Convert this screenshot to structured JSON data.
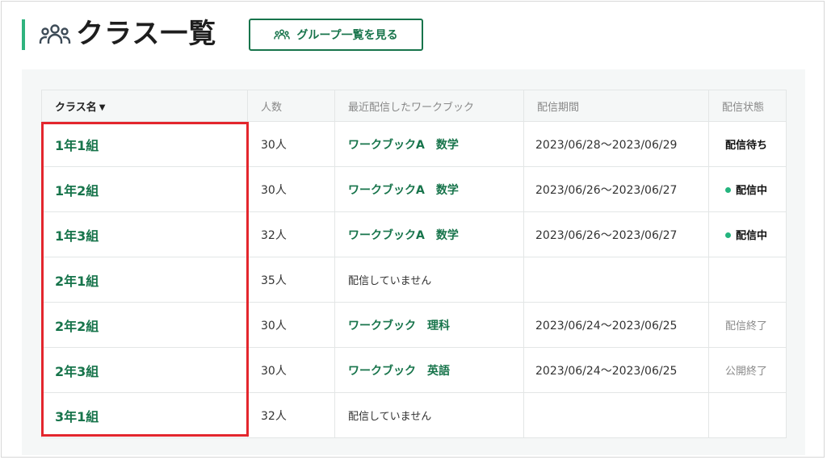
{
  "header": {
    "title": "クラス一覧",
    "group_button_label": "グループ一覧を見る"
  },
  "table": {
    "columns": [
      "クラス名",
      "人数",
      "最近配信したワークブック",
      "配信期間",
      "配信状態"
    ],
    "rows": [
      {
        "name": "1年1組",
        "count": "30人",
        "workbook": "ワークブックA　数学",
        "period": "2023/06/28〜2023/06/29",
        "status": "配信待ち"
      },
      {
        "name": "1年2組",
        "count": "30人",
        "workbook": "ワークブックA　数学",
        "period": "2023/06/26〜2023/06/27",
        "status": "配信中"
      },
      {
        "name": "1年3組",
        "count": "32人",
        "workbook": "ワークブックA　数学",
        "period": "2023/06/26〜2023/06/27",
        "status": "配信中"
      },
      {
        "name": "2年1組",
        "count": "35人",
        "workbook": "配信していません",
        "period": "",
        "status": ""
      },
      {
        "name": "2年2組",
        "count": "30人",
        "workbook": "ワークブック　理科",
        "period": "2023/06/24〜2023/06/25",
        "status": "配信終了"
      },
      {
        "name": "2年3組",
        "count": "30人",
        "workbook": "ワークブック　英語",
        "period": "2023/06/24〜2023/06/25",
        "status": "公開終了"
      },
      {
        "name": "3年1組",
        "count": "32人",
        "workbook": "配信していません",
        "period": "",
        "status": ""
      }
    ]
  },
  "colors": {
    "accent": "#2fb37e",
    "brand_green": "#17744b",
    "status_dot": "#24b47e",
    "highlight": "#e3262d"
  },
  "icons": {
    "title": "people-group-icon",
    "button": "people-group-icon",
    "sort": "caret-down-icon",
    "status_active": "green-dot-icon"
  }
}
